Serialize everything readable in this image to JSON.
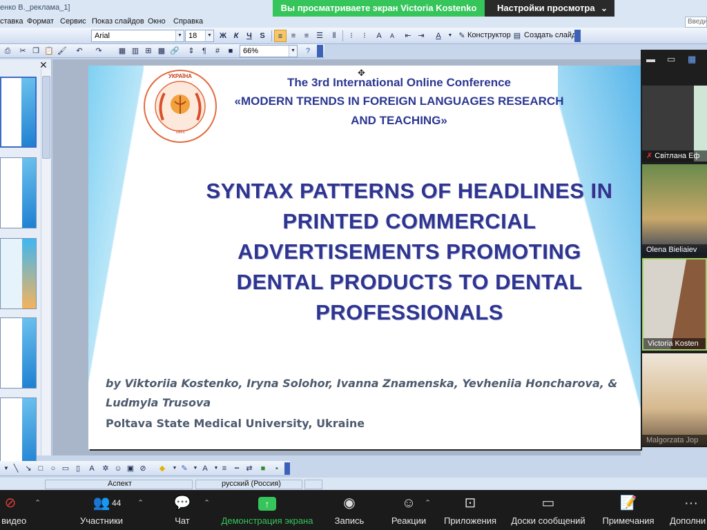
{
  "window": {
    "title": "енко В._реклама_1]"
  },
  "zoom_banner": {
    "sharing": "Вы просматриваете экран Victoria Kostenko",
    "view_settings": "Настройки просмотра"
  },
  "menu": [
    "ставка",
    "Формат",
    "Сервис",
    "Показ слайдов",
    "Окно",
    "Справка"
  ],
  "search": {
    "placeholder": "Введи"
  },
  "toolbar": {
    "font": "Arial",
    "size": "18",
    "bold": "Ж",
    "italic": "К",
    "underline": "Ч",
    "shadow": "S",
    "designer": "Конструктор",
    "new_slide": "Создать слайд",
    "zoom": "66%"
  },
  "slide": {
    "conf_line1": "The 3rd International Online Conference",
    "conf_line2": "«MODERN TRENDS IN FOREIGN LANGUAGES RESEARCH",
    "conf_line3": "AND TEACHING»",
    "headline": [
      "SYNTAX PATTERNS OF HEADLINES IN",
      "PRINTED COMMERCIAL",
      "ADVERTISEMENTS PROMOTING",
      "DENTAL PRODUCTS TO DENTAL",
      "PROFESSIONALS"
    ],
    "authors_line1": "by Viktoriia Kostenko, Iryna Solohor, Ivanna Znamenska, Yevheniia Honcharova, &",
    "authors_line2": "Ludmyla Trusova",
    "university": "Poltava State Medical University, Ukraine",
    "emblem_text": "УКРАЇНА ПОЛТАВСЬКИЙ ДЕРЖАВНИЙ МЕДИЧНИЙ УНІВЕРСИТЕТ 1921"
  },
  "status": {
    "aspect": "Аспект",
    "language": "русский (Россия)"
  },
  "participants_video": [
    {
      "name": "Світлана Еф"
    },
    {
      "name": "Olena Bieliaiev"
    },
    {
      "name": "Victoria Kosten"
    },
    {
      "name": "Malgorzata Jop"
    }
  ],
  "zoombar": {
    "video": "ь видео",
    "participants": "Участники",
    "participants_count": "44",
    "chat": "Чат",
    "share": "Демонстрация экрана",
    "record": "Запись",
    "reactions": "Реакции",
    "apps": "Приложения",
    "boards": "Доски сообщений",
    "notes": "Примечания",
    "more": "Дополни"
  },
  "colors": {
    "accent_green": "#35c55a",
    "slide_title": "#2e3590",
    "author_text": "#4d5b6e"
  }
}
